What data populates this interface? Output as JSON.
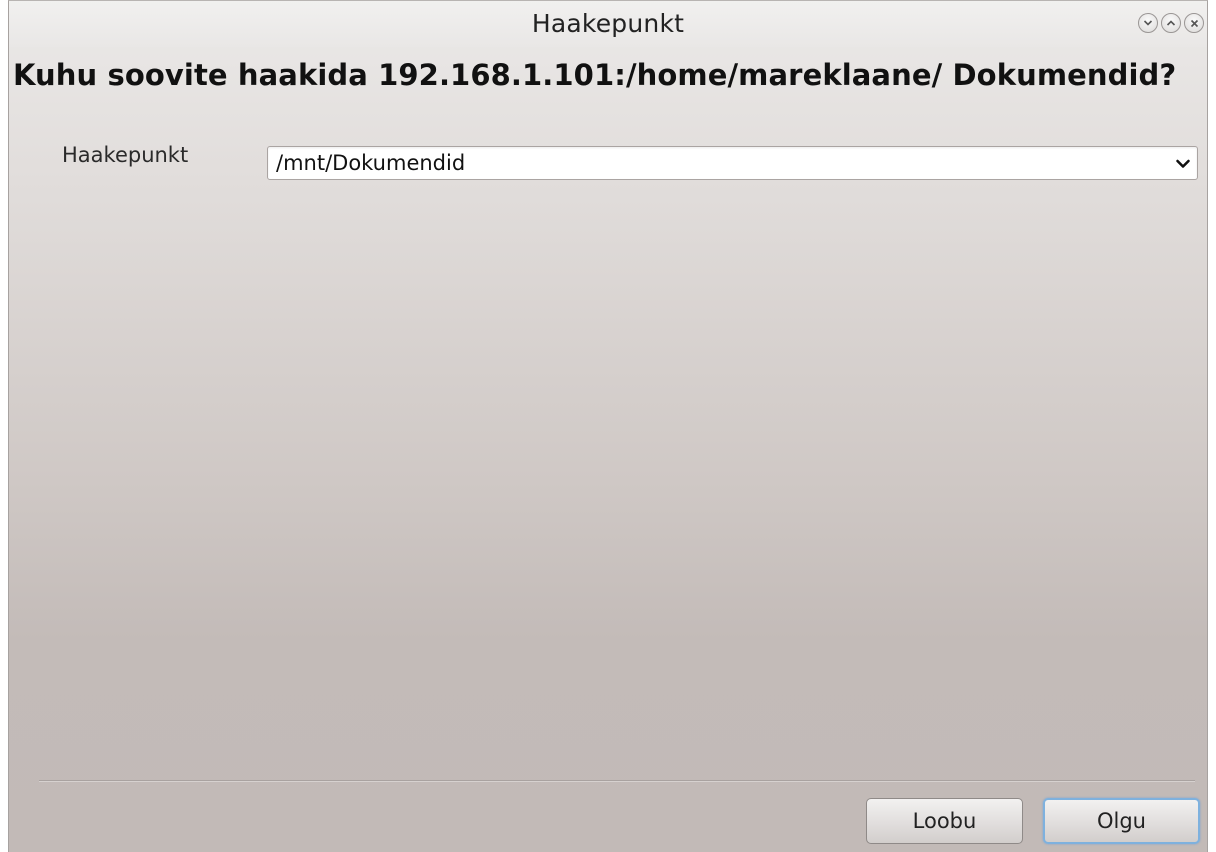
{
  "window": {
    "title": "Haakepunkt",
    "controls": {
      "minimize_icon": "chevron-down-circle-icon",
      "maximize_icon": "chevron-up-circle-icon",
      "close_icon": "close-circle-icon"
    }
  },
  "dialog": {
    "question": "Kuhu soovite haakida 192.168.1.101:/home/mareklaane/ Dokumendid?",
    "mountpoint": {
      "label": "Haakepunkt",
      "value": "/mnt/Dokumendid"
    }
  },
  "buttons": {
    "cancel_label": "Loobu",
    "ok_label": "Olgu"
  },
  "colors": {
    "default_button_border": "#7eb1de",
    "window_background": "#c3bbb8"
  }
}
